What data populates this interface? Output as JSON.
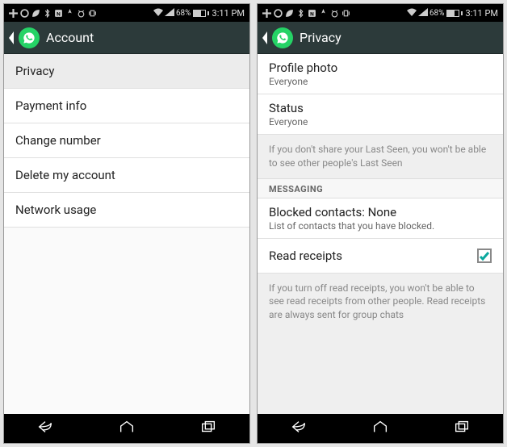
{
  "status": {
    "battery_pct": "68%",
    "time": "3:11 PM"
  },
  "left": {
    "title": "Account",
    "items": [
      "Privacy",
      "Payment info",
      "Change number",
      "Delete my account",
      "Network usage"
    ]
  },
  "right": {
    "title": "Privacy",
    "profile_photo": {
      "label": "Profile photo",
      "value": "Everyone"
    },
    "status_row": {
      "label": "Status",
      "value": "Everyone"
    },
    "last_seen_note": "If you don't share your Last Seen, you won't be able to see other people's Last Seen",
    "messaging_header": "MESSAGING",
    "blocked": {
      "label": "Blocked contacts: None",
      "desc": "List of contacts that you have blocked."
    },
    "read_receipts_label": "Read receipts",
    "read_receipts_note": "If you turn off read receipts, you won't be able to see read receipts from other people. Read receipts are always sent for group chats"
  }
}
